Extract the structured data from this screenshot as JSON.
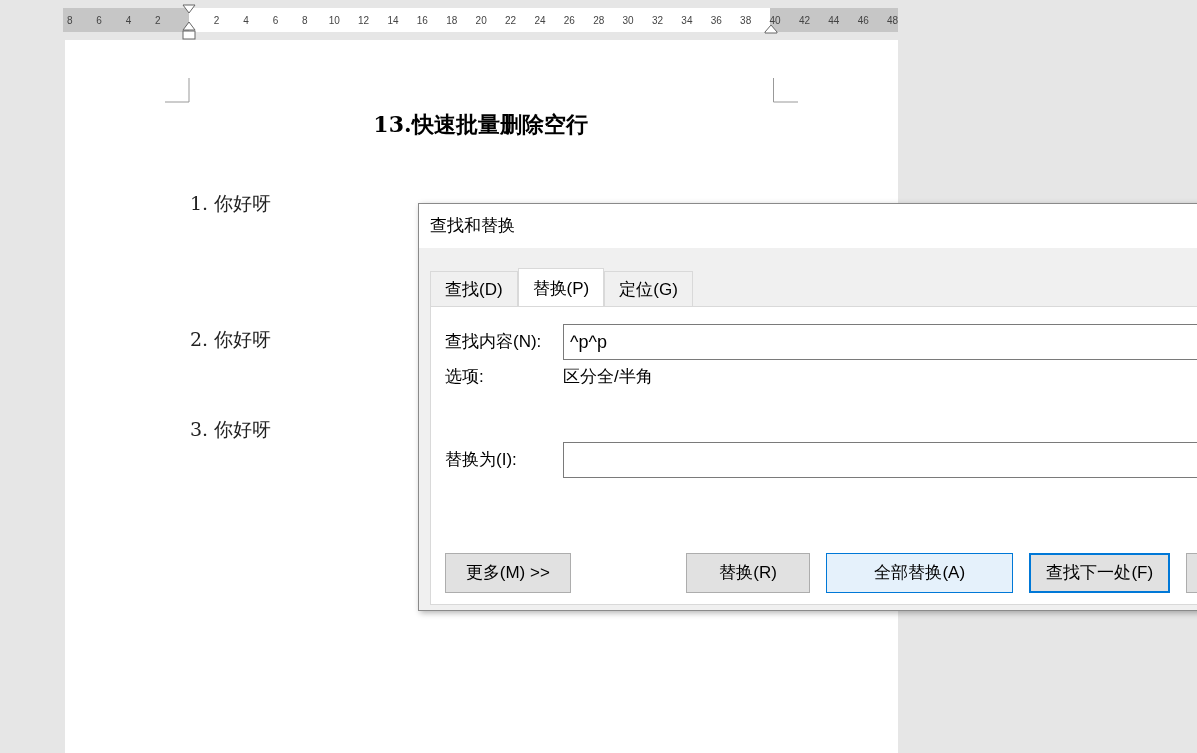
{
  "ruler": {
    "left_labels": [
      "8",
      "6",
      "4",
      "2"
    ],
    "labels": [
      "2",
      "4",
      "6",
      "8",
      "10",
      "12",
      "14",
      "16",
      "18",
      "20",
      "22",
      "24",
      "26",
      "28",
      "30",
      "32",
      "34",
      "36",
      "38",
      "40",
      "42",
      "44",
      "46",
      "48"
    ]
  },
  "document": {
    "title": "13.快速批量删除空行",
    "paragraphs": [
      "1. 你好呀",
      "2. 你好呀",
      "3. 你好呀"
    ]
  },
  "dialog": {
    "title": "查找和替换",
    "tabs": [
      {
        "label": "查找(D)",
        "selected": false
      },
      {
        "label": "替换(P)",
        "selected": true
      },
      {
        "label": "定位(G)",
        "selected": false
      }
    ],
    "find_field": {
      "label": "查找内容(N):",
      "value": "^p^p"
    },
    "options": {
      "label": "选项:",
      "value": "区分全/半角"
    },
    "replace_field": {
      "label": "替换为(I):"
    },
    "more_button": {
      "label": "更多(M) >>"
    },
    "buttons": [
      {
        "label": "替换(R)",
        "highlighted": false,
        "default": false
      },
      {
        "label": "全部替换(A)",
        "highlighted": true,
        "default": false
      },
      {
        "label": "查找下一处(F)",
        "highlighted": false,
        "default": true
      }
    ]
  }
}
